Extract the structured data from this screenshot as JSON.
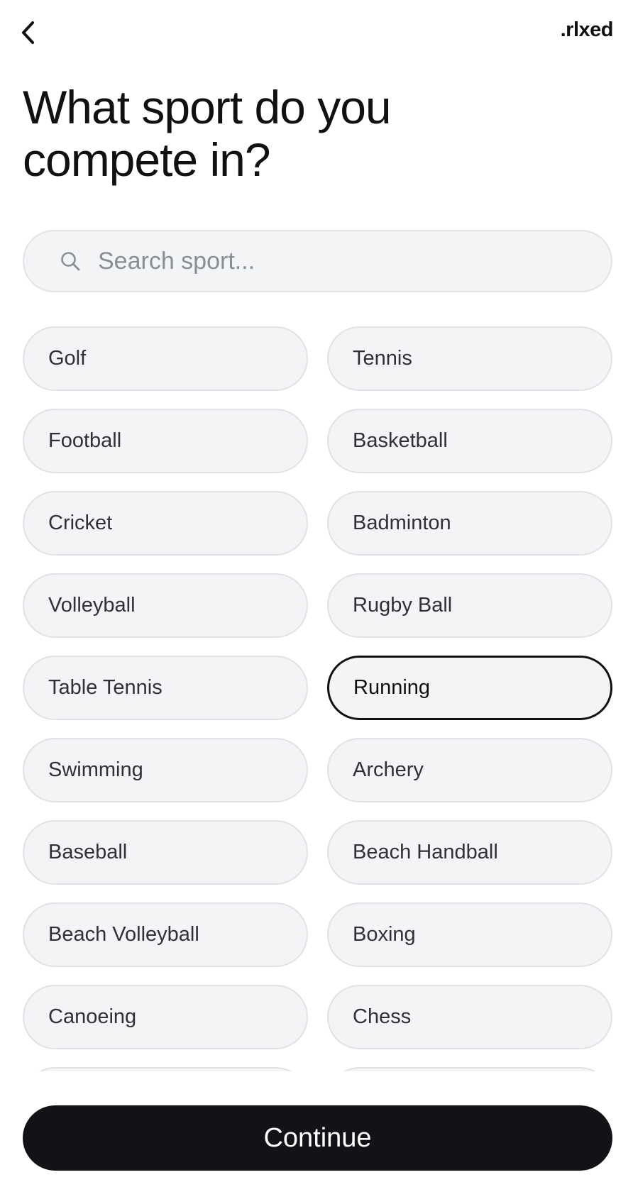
{
  "header": {
    "back_icon": "chevron-left-icon",
    "brand": ".rlxed"
  },
  "title": "What sport do you compete in?",
  "search": {
    "icon": "search-icon",
    "placeholder": "Search sport...",
    "value": ""
  },
  "sports": [
    {
      "label": "Golf",
      "selected": false
    },
    {
      "label": "Tennis",
      "selected": false
    },
    {
      "label": "Football",
      "selected": false
    },
    {
      "label": "Basketball",
      "selected": false
    },
    {
      "label": "Cricket",
      "selected": false
    },
    {
      "label": "Badminton",
      "selected": false
    },
    {
      "label": "Volleyball",
      "selected": false
    },
    {
      "label": "Rugby Ball",
      "selected": false
    },
    {
      "label": "Table Tennis",
      "selected": false
    },
    {
      "label": "Running",
      "selected": true
    },
    {
      "label": "Swimming",
      "selected": false
    },
    {
      "label": "Archery",
      "selected": false
    },
    {
      "label": "Baseball",
      "selected": false
    },
    {
      "label": "Beach Handball",
      "selected": false
    },
    {
      "label": "Beach Volleyball",
      "selected": false
    },
    {
      "label": "Boxing",
      "selected": false
    },
    {
      "label": "Canoeing",
      "selected": false
    },
    {
      "label": "Chess",
      "selected": false
    },
    {
      "label": "",
      "selected": false
    },
    {
      "label": "",
      "selected": false
    }
  ],
  "footer": {
    "continue_label": "Continue"
  },
  "colors": {
    "pill_bg": "#f3f4f6",
    "pill_border": "#e1e2e5",
    "selected_border": "#111111",
    "button_bg": "#121316",
    "button_text": "#ffffff"
  }
}
